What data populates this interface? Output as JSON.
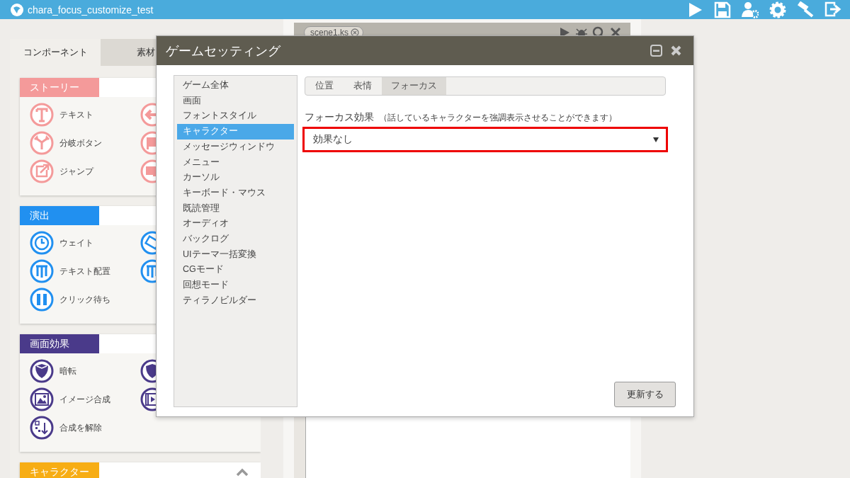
{
  "app": {
    "title": "chara_focus_customize_test"
  },
  "left_panel": {
    "tabs": [
      {
        "label": "コンポーネント",
        "selected": true
      },
      {
        "label": "素材",
        "selected": false
      }
    ],
    "sections": [
      {
        "title": "ストーリー",
        "color": "#f49a9a",
        "items": [
          {
            "label": "テキスト"
          },
          {
            "label": "分岐ボタン"
          },
          {
            "label": "ジャンプ"
          }
        ]
      },
      {
        "title": "演出",
        "color": "#2190f0",
        "items": [
          {
            "label": "ウェイト"
          },
          {
            "label": "テキスト配置"
          },
          {
            "label": "クリック待ち"
          }
        ]
      },
      {
        "title": "画面効果",
        "color": "#4a3a8a",
        "items": [
          {
            "label": "暗転"
          },
          {
            "label": "イメージ合成"
          },
          {
            "label": "合成を解除"
          }
        ]
      },
      {
        "title": "キャラクター",
        "color": "#f7ad14"
      }
    ]
  },
  "editor": {
    "file_tab": "scene1.ks"
  },
  "dialog": {
    "title": "ゲームセッティング",
    "menu": [
      {
        "label": "ゲーム全体",
        "selected": false
      },
      {
        "label": "画面",
        "selected": false
      },
      {
        "label": "フォントスタイル",
        "selected": false
      },
      {
        "label": "キャラクター",
        "selected": true
      },
      {
        "label": "メッセージウィンドウ",
        "selected": false
      },
      {
        "label": "メニュー",
        "selected": false
      },
      {
        "label": "カーソル",
        "selected": false
      },
      {
        "label": "キーボード・マウス",
        "selected": false
      },
      {
        "label": "既読管理",
        "selected": false
      },
      {
        "label": "オーディオ",
        "selected": false
      },
      {
        "label": "バックログ",
        "selected": false
      },
      {
        "label": "UIテーマ一括変換",
        "selected": false
      },
      {
        "label": "CGモード",
        "selected": false
      },
      {
        "label": "回想モード",
        "selected": false
      },
      {
        "label": "ティラノビルダー",
        "selected": false
      }
    ],
    "tabs": [
      {
        "label": "位置",
        "selected": false
      },
      {
        "label": "表情",
        "selected": false
      },
      {
        "label": "フォーカス",
        "selected": true
      }
    ],
    "field_label": "フォーカス効果",
    "field_hint": "（話しているキャラクターを強調表示させることができます）",
    "select": {
      "value": "効果なし",
      "highlighted": true
    },
    "button": "更新する"
  }
}
